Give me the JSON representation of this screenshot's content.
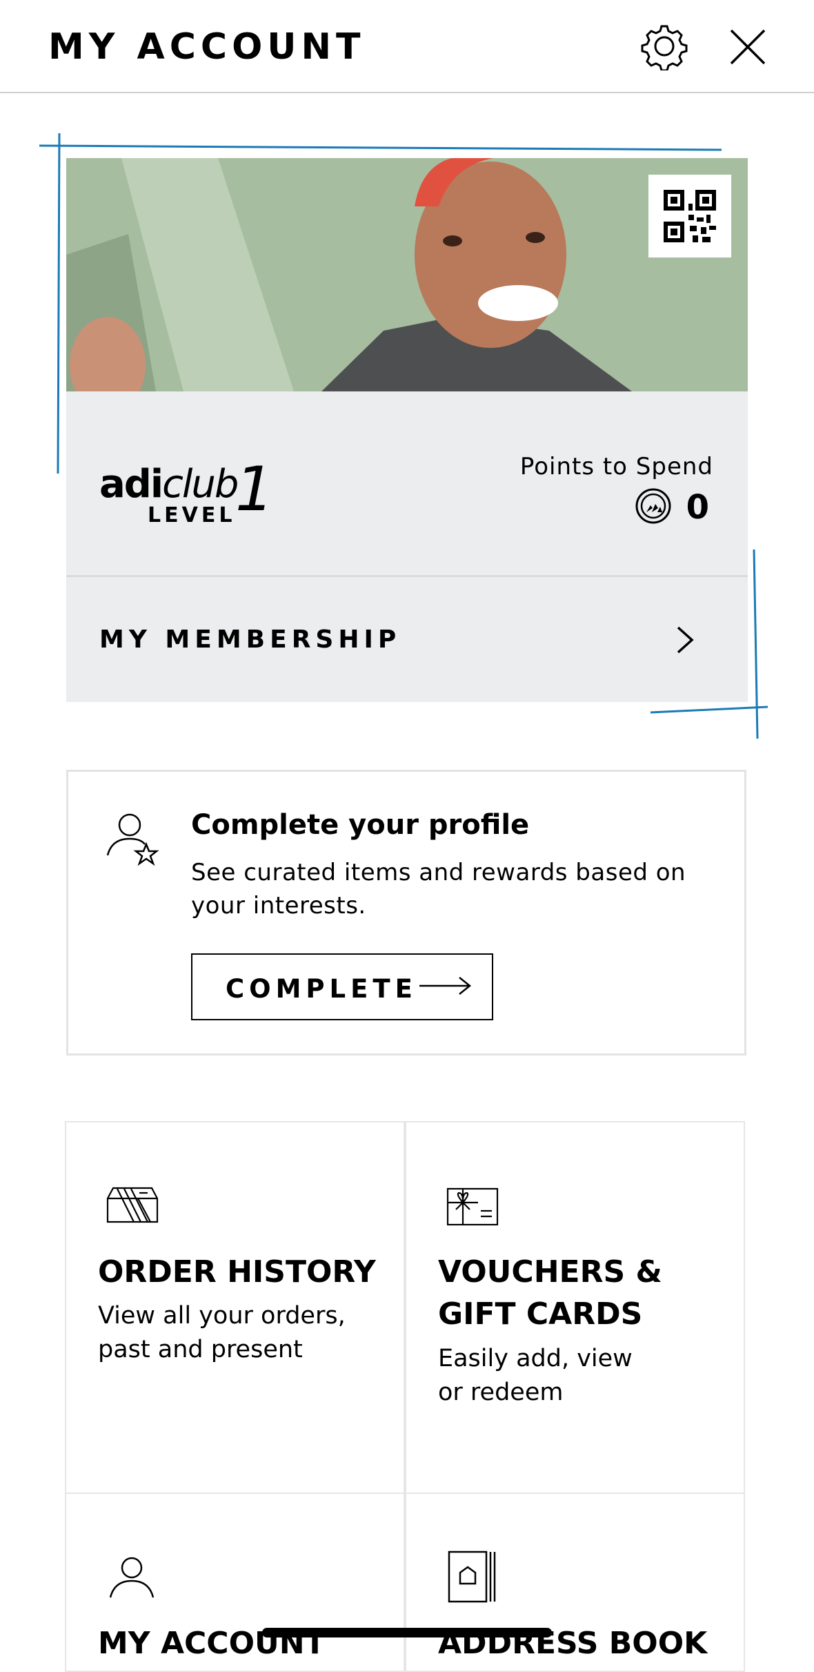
{
  "header": {
    "title": "MY ACCOUNT",
    "settings_icon": "gear-icon",
    "close_icon": "close-icon"
  },
  "membership_card": {
    "qr_icon": "qr-code-icon",
    "brand_regular": "adi",
    "brand_italic": "club",
    "level_label": "LEVEL",
    "level_number": "1",
    "points_label": "Points to Spend",
    "points_value": "0",
    "points_icon": "adiclub-points-icon",
    "membership_label": "MY MEMBERSHIP",
    "membership_icon": "chevron-right-icon"
  },
  "profile_prompt": {
    "icon": "user-star-icon",
    "title": "Complete your profile",
    "description": "See curated items and rewards based on your interests.",
    "button_label": "COMPLETE",
    "button_icon": "arrow-right-icon"
  },
  "tiles": [
    {
      "icon": "order-box-icon",
      "title_line1": "ORDER HISTORY",
      "title_line2": "",
      "desc_line1": "View all your orders,",
      "desc_line2": "past and present"
    },
    {
      "icon": "gift-card-icon",
      "title_line1": "VOUCHERS &",
      "title_line2": "GIFT CARDS",
      "desc_line1": "Easily add, view",
      "desc_line2": "or redeem"
    },
    {
      "icon": "user-icon",
      "title_line1": "MY ACCOUNT",
      "title_line2": "",
      "desc_line1": "",
      "desc_line2": ""
    },
    {
      "icon": "address-book-icon",
      "title_line1": "ADDRESS BOOK",
      "title_line2": "",
      "desc_line1": "",
      "desc_line2": ""
    }
  ],
  "colors": {
    "annotation_blue": "#1a7ab5",
    "card_grey": "#ecedee"
  }
}
